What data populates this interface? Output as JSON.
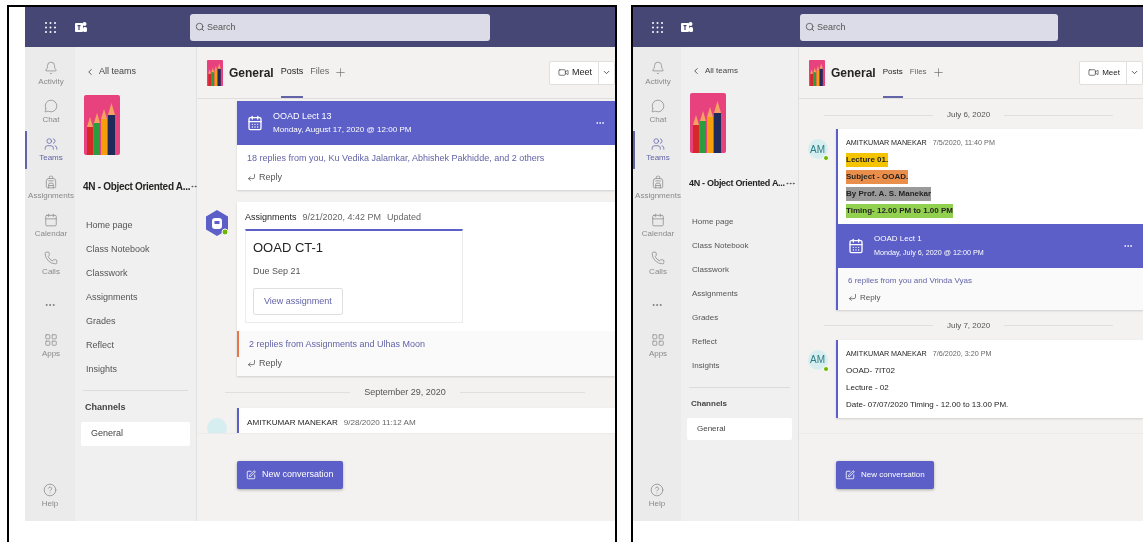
{
  "windows": [
    {
      "search": {
        "placeholder": "Search"
      },
      "rail": [
        {
          "label": "Activity",
          "selected": false
        },
        {
          "label": "Chat",
          "selected": false
        },
        {
          "label": "Teams",
          "selected": true
        },
        {
          "label": "Assignments",
          "selected": false
        },
        {
          "label": "Calendar",
          "selected": false
        },
        {
          "label": "Calls",
          "selected": false
        },
        {
          "label": "Apps",
          "selected": false
        }
      ],
      "help": "Help",
      "sidebar": {
        "back": "All teams",
        "team_name": "4N - Object Oriented A...",
        "nav": [
          "Home page",
          "Class Notebook",
          "Classwork",
          "Assignments",
          "Grades",
          "Reflect",
          "Insights"
        ],
        "channels_heading": "Channels",
        "channels": [
          {
            "label": "General",
            "selected": true
          }
        ]
      },
      "channel": {
        "title": "General",
        "tabs": [
          {
            "label": "Posts",
            "selected": true
          },
          {
            "label": "Files",
            "selected": false
          }
        ],
        "meet": "Meet"
      },
      "posts": [
        {
          "kind": "meeting",
          "meeting": {
            "title": "OOAD Lect 13",
            "time": "Monday, August 17, 2020 @ 12:00 PM"
          },
          "replies": "18 replies from you, Ku Vedika Jalamkar, Abhishek Pakhidde, and 2 others",
          "reply": "Reply"
        },
        {
          "kind": "assignment",
          "author": "Assignments",
          "time": "9/21/2020, 4:42 PM",
          "tag": "Updated",
          "title": "OOAD CT-1",
          "due": "Due Sep 21",
          "button": "View assignment",
          "replies": "2 replies from Assignments and Ulhas Moon",
          "reply": "Reply"
        },
        {
          "kind": "date",
          "text": "September 29, 2020"
        },
        {
          "kind": "message",
          "author": "AMITKUMAR MANEKAR",
          "time": "9/28/2020 11:12 AM"
        }
      ],
      "new_conversation": "New conversation"
    },
    {
      "search": {
        "placeholder": "Search"
      },
      "rail": [
        {
          "label": "Activity",
          "selected": false
        },
        {
          "label": "Chat",
          "selected": false
        },
        {
          "label": "Teams",
          "selected": true
        },
        {
          "label": "Assignments",
          "selected": false
        },
        {
          "label": "Calendar",
          "selected": false
        },
        {
          "label": "Calls",
          "selected": false
        },
        {
          "label": "Apps",
          "selected": false
        }
      ],
      "help": "Help",
      "sidebar": {
        "back": "All teams",
        "team_name": "4N - Object Oriented A...",
        "nav": [
          "Home page",
          "Class Notebook",
          "Classwork",
          "Assignments",
          "Grades",
          "Reflect",
          "Insights"
        ],
        "channels_heading": "Channels",
        "channels": [
          {
            "label": "General",
            "selected": true
          }
        ]
      },
      "channel": {
        "title": "General",
        "tabs": [
          {
            "label": "Posts",
            "selected": true
          },
          {
            "label": "Files",
            "selected": false
          }
        ],
        "meet": "Meet"
      },
      "posts": [
        {
          "kind": "date",
          "text": "July 6, 2020"
        },
        {
          "kind": "message",
          "initials": "AM",
          "author": "AMITKUMAR MANEKAR",
          "time": "7/5/2020, 11:40 PM",
          "lines": [
            {
              "text": "Lecture 01.",
              "bold": true,
              "color": "#f5c400"
            },
            {
              "text": "Subject - OOAD.",
              "bold": true,
              "color": "#e98f4b"
            },
            {
              "text": "By Prof. A. S. Manekar",
              "bold": true,
              "color": "#9a9a9a"
            },
            {
              "text": "Timing- 12.00 PM to 1.00 PM",
              "bold": true,
              "color": "#92d050"
            }
          ],
          "meeting": {
            "title": "OOAD Lect 1",
            "time": "Monday, July 6, 2020 @ 12:00 PM"
          },
          "replies": "6 replies from you and Vrinda Vyas",
          "reply": "Reply"
        },
        {
          "kind": "date",
          "text": "July 7, 2020"
        },
        {
          "kind": "message",
          "initials": "AM",
          "author": "AMITKUMAR MANEKAR",
          "time": "7/6/2020, 3:20 PM",
          "lines": [
            {
              "text": "OOAD- 7IT02",
              "bold": false
            },
            {
              "text": "Lecture - 02",
              "bold": false
            },
            {
              "text": "Date- 07/07/2020 Timing - 12.00 to 13.00 PM.",
              "bold": false
            }
          ]
        }
      ],
      "new_conversation": "New conversation"
    }
  ]
}
